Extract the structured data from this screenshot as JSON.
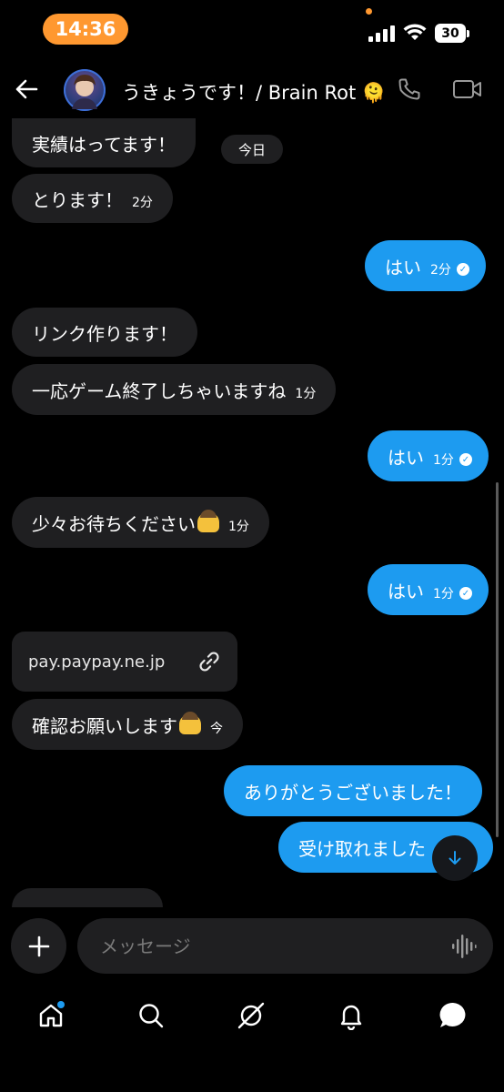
{
  "status_bar": {
    "time": "14:36",
    "battery": "30"
  },
  "header": {
    "title": "うきょうです！/ Brain Rot 🫠"
  },
  "messages": {
    "m1": {
      "text": "実績はってます！"
    },
    "today_badge": "今日",
    "m2": {
      "text": "とります！",
      "time": "2分"
    },
    "m3": {
      "text": "はい",
      "time": "2分"
    },
    "m4": {
      "text": "リンク作ります！"
    },
    "m5": {
      "text": "一応ゲーム終了しちゃいますね",
      "time": "1分"
    },
    "m6": {
      "text": "はい",
      "time": "1分"
    },
    "m7": {
      "text": "少々お待ちください",
      "time": "1分"
    },
    "m8": {
      "text": "はい",
      "time": "1分"
    },
    "link_card": {
      "domain": "pay.paypay.ne.jp"
    },
    "m9": {
      "text": "確認お願いします",
      "time": "今"
    },
    "m10": {
      "text": "ありがとうございました！"
    },
    "m11": {
      "text": "受け取れました"
    }
  },
  "composer": {
    "placeholder": "メッセージ"
  },
  "colors": {
    "sent_bubble": "#1d9bf0",
    "received_bubble": "#1f1f21",
    "status_pill": "#ff9830"
  },
  "icons": {
    "header": [
      "back-arrow-icon",
      "phone-icon",
      "video-camera-icon"
    ],
    "nav": [
      "home-icon",
      "search-icon",
      "grok-icon",
      "notifications-icon",
      "messages-icon"
    ]
  }
}
